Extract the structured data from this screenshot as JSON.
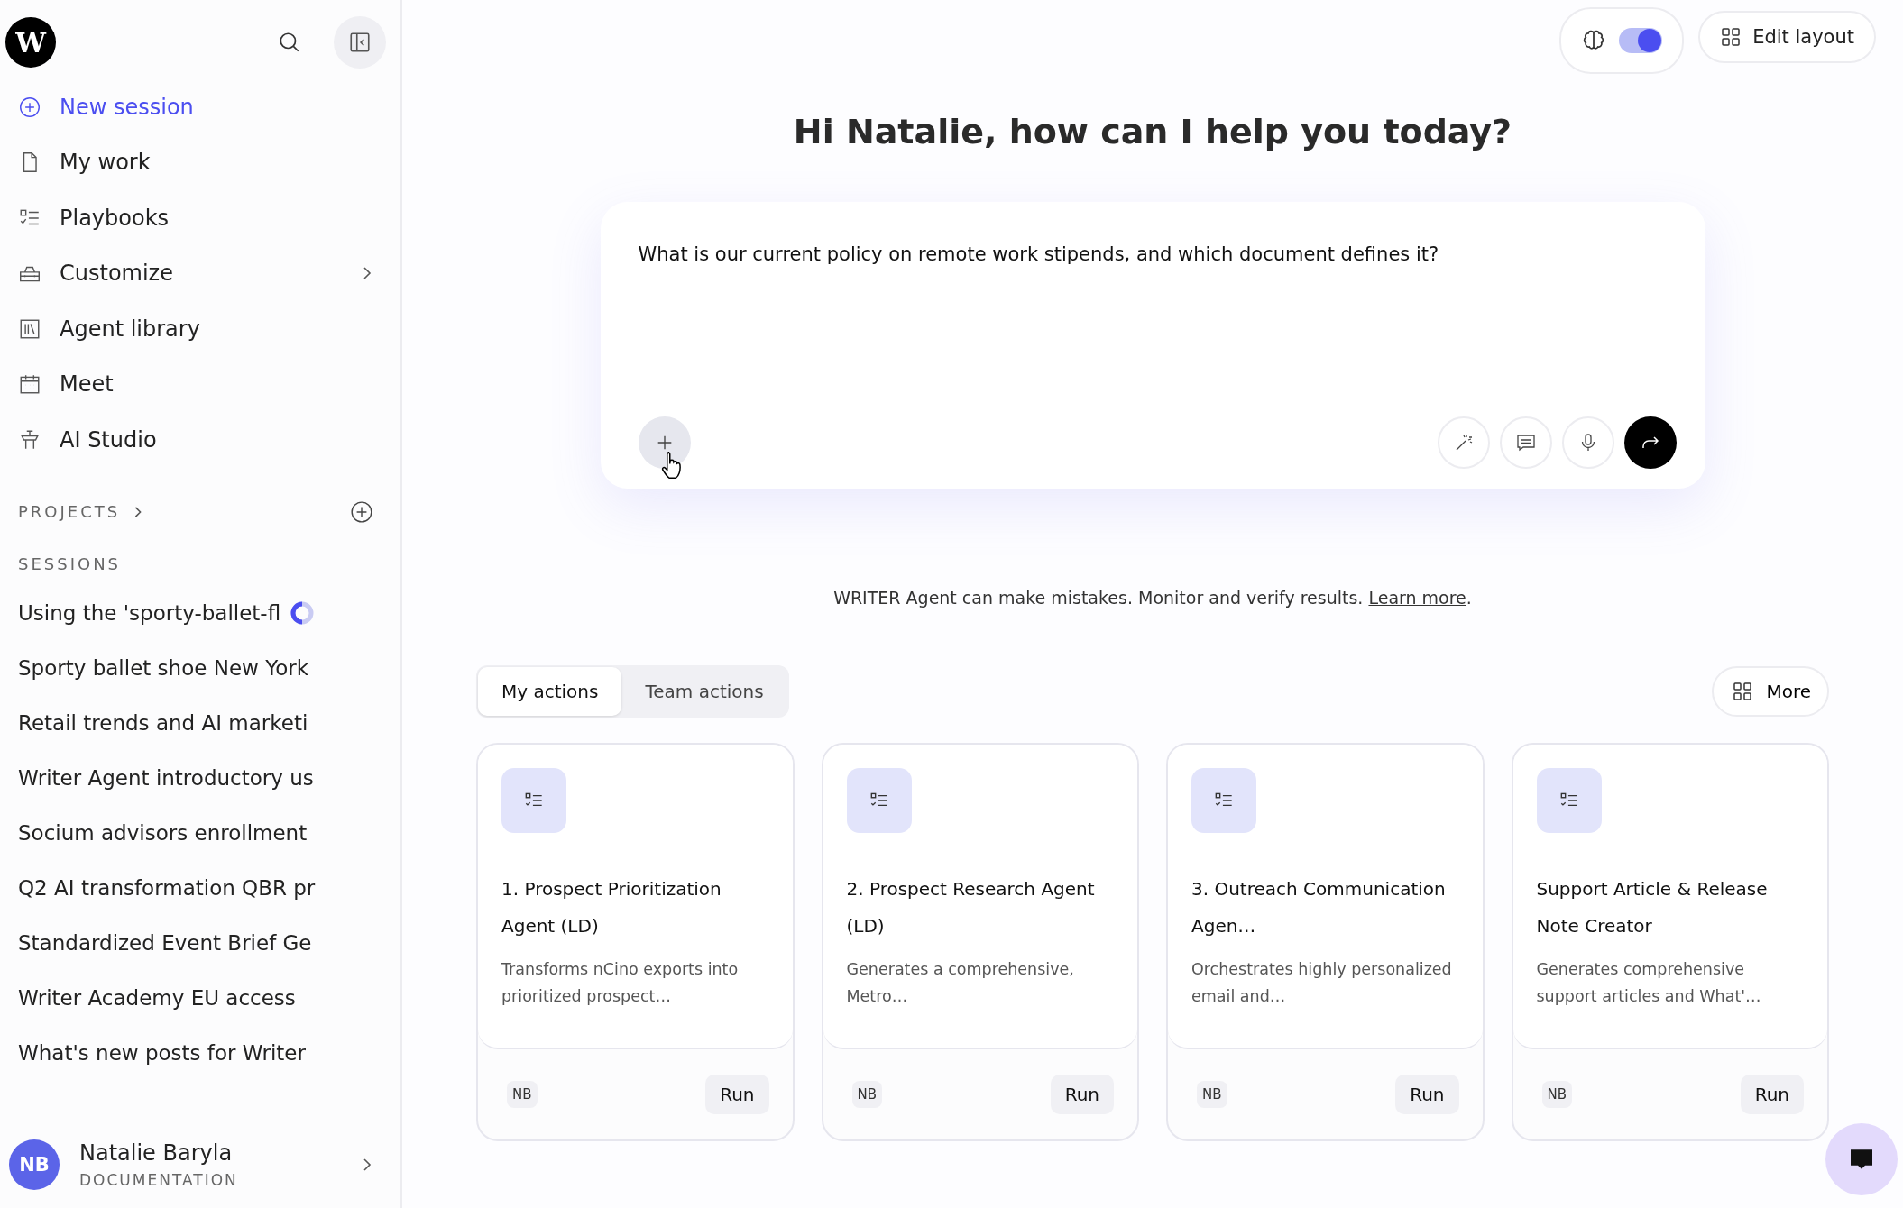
{
  "sidebar": {
    "logo": "W",
    "nav": [
      {
        "label": "New session",
        "kind": "action",
        "expandable": false
      },
      {
        "label": "My work",
        "kind": "link",
        "expandable": false
      },
      {
        "label": "Playbooks",
        "kind": "link",
        "expandable": false
      },
      {
        "label": "Customize",
        "kind": "link",
        "expandable": true
      },
      {
        "label": "Agent library",
        "kind": "link",
        "expandable": false
      },
      {
        "label": "Meet",
        "kind": "link",
        "expandable": false
      },
      {
        "label": "AI Studio",
        "kind": "link",
        "expandable": false
      }
    ],
    "projects_heading": "PROJECTS",
    "sessions_heading": "SESSIONS",
    "sessions": [
      {
        "title": "Using the 'sporty-ballet-fl",
        "loading": true
      },
      {
        "title": "Sporty ballet shoe New York",
        "loading": false
      },
      {
        "title": "Retail trends and AI marketi",
        "loading": false
      },
      {
        "title": "Writer Agent introductory us",
        "loading": false
      },
      {
        "title": "Socium advisors enrollment",
        "loading": false
      },
      {
        "title": "Q2 AI transformation QBR pr",
        "loading": false
      },
      {
        "title": "Standardized Event Brief Ge",
        "loading": false
      },
      {
        "title": "Writer Academy EU access",
        "loading": false
      },
      {
        "title": "What's new posts for Writer",
        "loading": false
      }
    ],
    "user": {
      "initials": "NB",
      "name": "Natalie Baryla",
      "org": "DOCUMENTATION"
    }
  },
  "topbar": {
    "agent_toggle": {
      "on": true
    },
    "edit_layout": "Edit layout"
  },
  "greeting": "Hi Natalie, how can I help you today?",
  "composer": {
    "value": "What is our current policy on remote work stipends, and which document defines it?"
  },
  "disclaimer": {
    "text": "WRITER Agent can make mistakes. Monitor and verify results.",
    "link": "Learn more",
    "after_link": "."
  },
  "tabs": [
    {
      "label": "My actions",
      "selected": true
    },
    {
      "label": "Team actions",
      "selected": false
    }
  ],
  "more_button": "More",
  "cards": [
    {
      "title": "1. Prospect Prioritization Agent (LD)",
      "description": "Transforms nCino exports into prioritized prospect…",
      "owner": "NB",
      "action": "Run"
    },
    {
      "title": "2. Prospect Research Agent (LD)",
      "description": "Generates a comprehensive, Metro…",
      "owner": "NB",
      "action": "Run"
    },
    {
      "title": "3. Outreach Communication Agen…",
      "description": "Orchestrates highly personalized email and…",
      "owner": "NB",
      "action": "Run"
    },
    {
      "title": "Support Article & Release Note Creator",
      "description": "Generates comprehensive support articles and What'…",
      "owner": "NB",
      "action": "Run"
    }
  ]
}
